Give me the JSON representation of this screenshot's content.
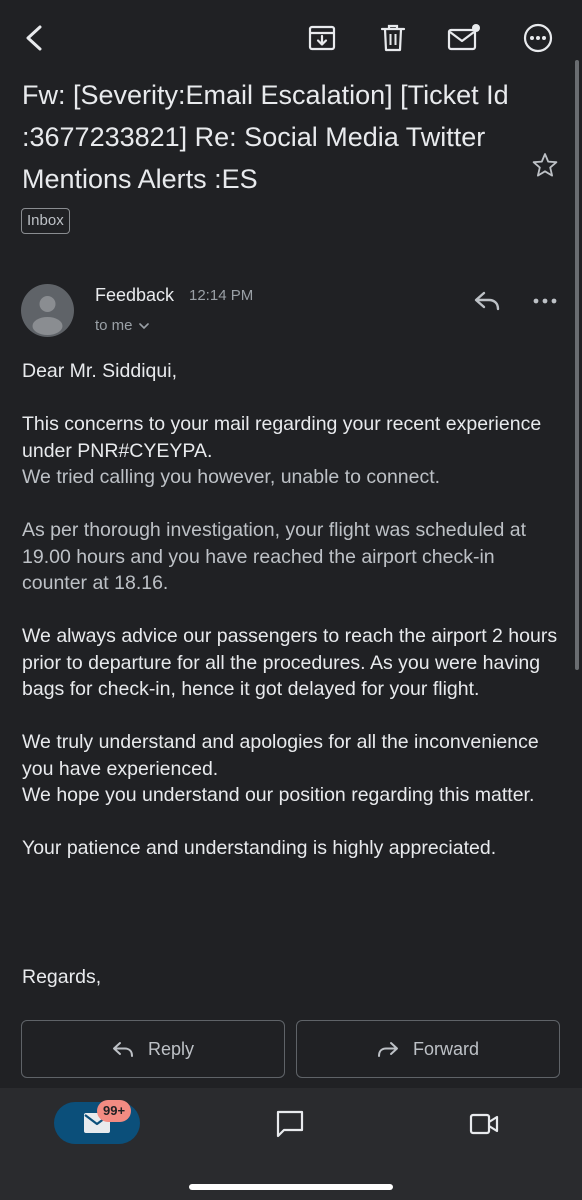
{
  "toolbar": {
    "back": "back-arrow-icon",
    "archive": "archive-icon",
    "delete": "trash-icon",
    "mark_unread": "mark-unread-icon",
    "more": "more-options-icon"
  },
  "email": {
    "subject": "Fw: [Severity:Email Escalation] [Ticket Id :3677233821] Re: Social Media  Twitter Mentions Alerts :ES",
    "label": "Inbox",
    "sender": "Feedback",
    "time": "12:14 PM",
    "recipient": "to me",
    "body": {
      "greeting": "Dear Mr. Siddiqui,",
      "p1_line1": "This concerns to your mail regarding your recent experience under PNR#CYEYPA.",
      "p1_line2": "We tried calling you however, unable to connect.",
      "p2": "As per thorough investigation, your flight was scheduled at 19.00 hours and you have reached the airport check-in counter at 18.16.",
      "p3": "We always advice our passengers to reach the airport 2 hours prior to departure for all the procedures. As you were having bags for check-in, hence it got delayed for your flight.",
      "p4_line1": "We truly understand and apologies for all the inconvenience you have experienced.",
      "p4_line2": "We hope you understand our position regarding this matter.",
      "p5": "Your patience and understanding is highly appreciated.",
      "closing": "Regards,"
    }
  },
  "actions": {
    "reply_label": "Reply",
    "forward_label": "Forward"
  },
  "bottom_nav": {
    "mail_badge": "99+"
  },
  "colors": {
    "background": "#202124",
    "text": "#e8eaed",
    "secondary_text": "#9aa0a6",
    "mail_pill": "#0b4f7a",
    "badge": "#f28b82"
  }
}
